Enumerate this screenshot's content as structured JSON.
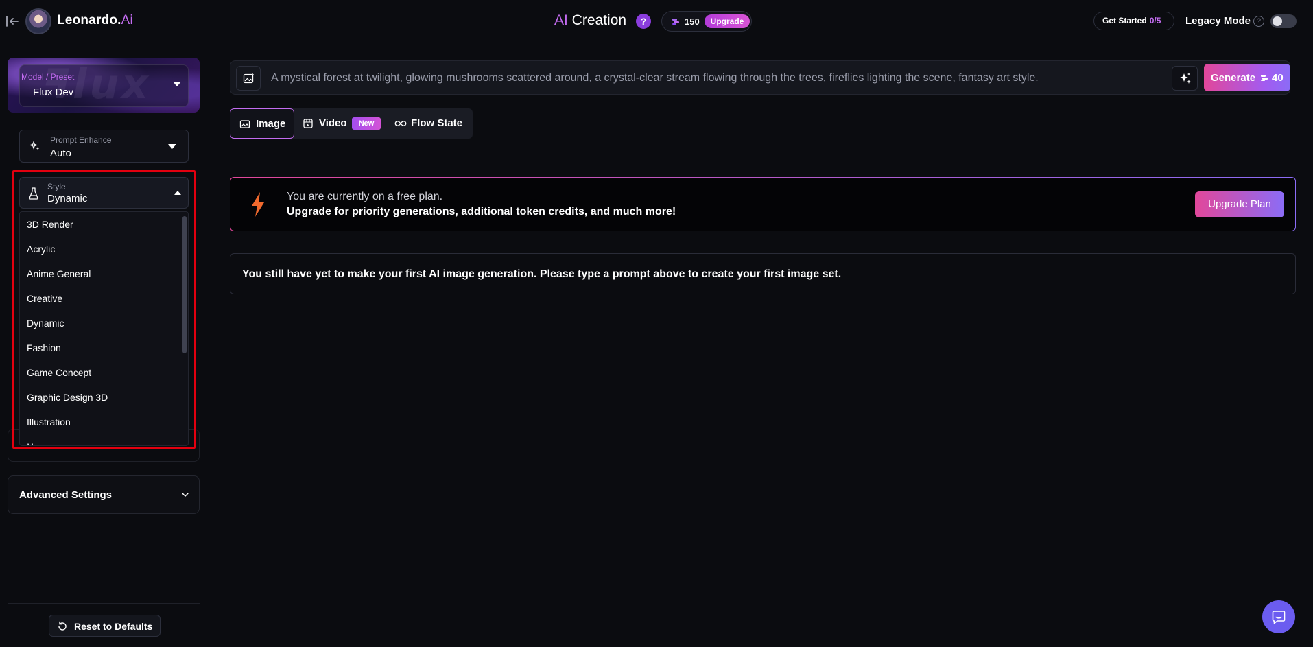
{
  "header": {
    "back_icon": "sidebar-collapse-icon",
    "brand_name": "Leonardo.",
    "brand_suffix": "Ai",
    "title_prefix": "AI",
    "title_rest": " Creation",
    "help_glyph": "?",
    "token_count": "150",
    "upgrade_label": "Upgrade",
    "get_started_label": "Get Started",
    "get_started_count": "0/5",
    "legacy_mode_label": "Legacy Mode",
    "legacy_help_glyph": "?",
    "legacy_mode_enabled": false
  },
  "sidebar": {
    "model": {
      "label": "Model / Preset",
      "value": "Flux Dev"
    },
    "prompt_enhance": {
      "label": "Prompt Enhance",
      "value": "Auto"
    },
    "style": {
      "label": "Style",
      "value": "Dynamic",
      "expanded": true,
      "options": [
        "3D Render",
        "Acrylic",
        "Anime General",
        "Creative",
        "Dynamic",
        "Fashion",
        "Game Concept",
        "Graphic Design 3D",
        "Illustration",
        "None"
      ]
    },
    "advanced_settings_label": "Advanced Settings",
    "reset_label": "Reset to Defaults"
  },
  "prompt": {
    "text": "A mystical forest at twilight, glowing mushrooms scattered around, a crystal-clear stream flowing through the trees, fireflies lighting the scene, fantasy art style.",
    "generate_label": "Generate",
    "generate_cost": "40"
  },
  "tabs": [
    {
      "label": "Image",
      "active": true
    },
    {
      "label": "Video",
      "badge": "New",
      "active": false
    },
    {
      "label": "Flow State",
      "active": false
    }
  ],
  "banner": {
    "line1": "You are currently on a free plan.",
    "line2": "Upgrade for priority generations, additional token credits, and much more!",
    "button": "Upgrade Plan"
  },
  "empty_state": "You still have yet to make your first AI image generation. Please type a prompt above to create your first image set.",
  "colors": {
    "background": "#0b0c10",
    "accent_purple": "#c36cf0",
    "gradient_pink": "#e2479a",
    "gradient_violet": "#8b6cf6",
    "highlight_red": "#e3000f"
  }
}
